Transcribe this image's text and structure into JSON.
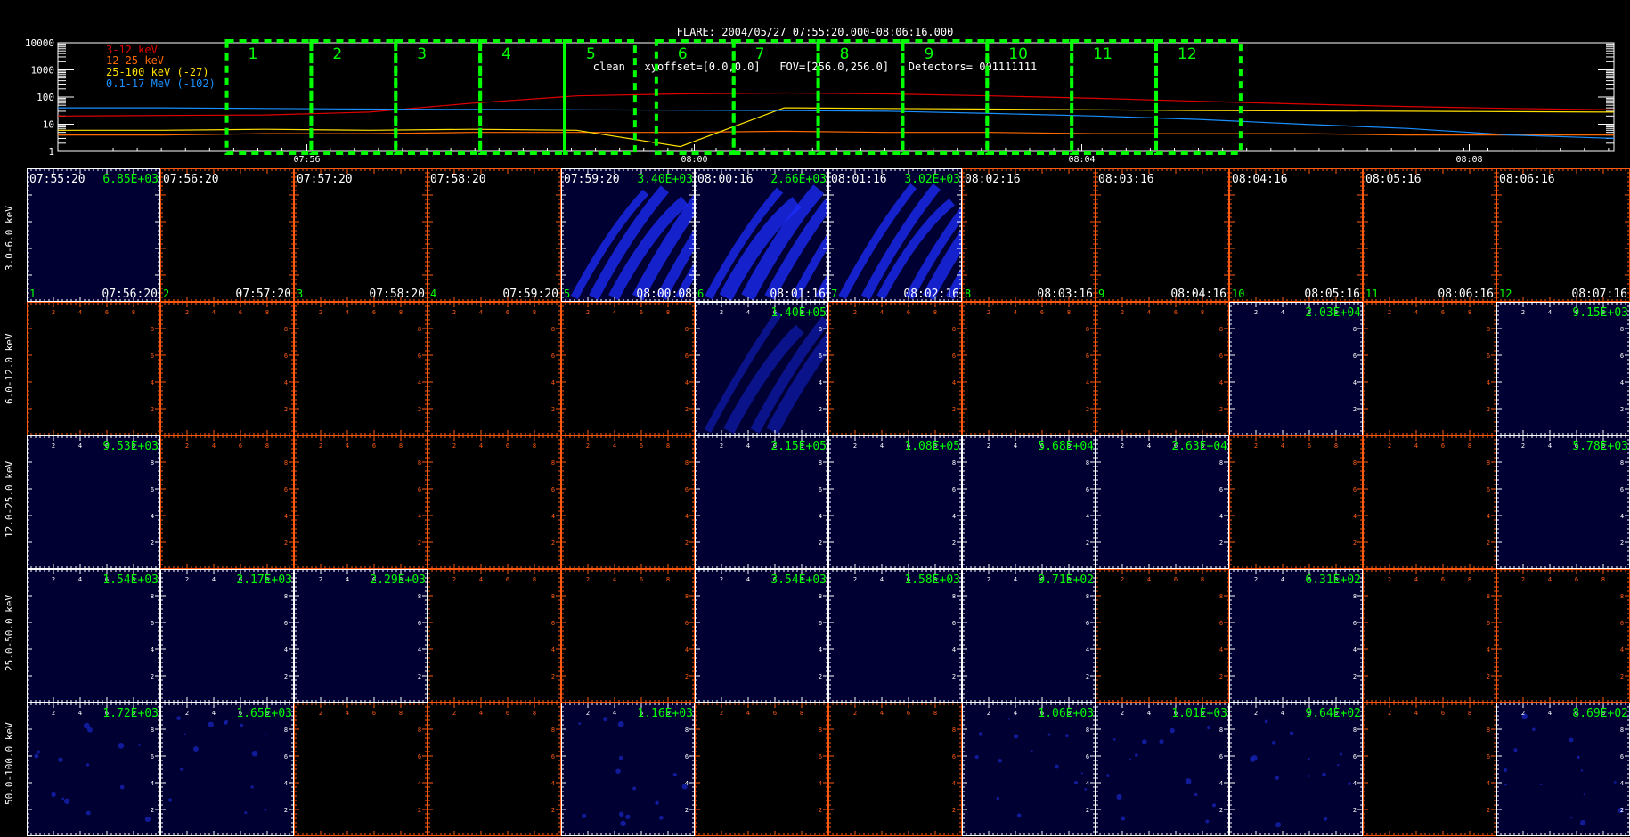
{
  "header": {
    "title": "FLARE: 2004/05/27 07:55:20.000-08:06:16.000",
    "subtitle": "clean   xyoffset=[0.0,0.0]   FOV=[256.0,256.0]   Detectors= 001111111"
  },
  "colors": {
    "frame": "#ff5a10",
    "panel_bg": "#000033",
    "window_box": "#00ff00",
    "label_green": "#00ff00",
    "series": [
      "#e00000",
      "#ff6a00",
      "#ffe000",
      "#1a90ff"
    ]
  },
  "chart_data": [
    {
      "type": "line",
      "yscale": "log",
      "ylim": [
        1,
        10000
      ],
      "yticks": [
        "10000",
        "1000",
        "100",
        "10",
        "1"
      ],
      "xticks": [
        "07:56",
        "08:00",
        "08:04",
        "08:08"
      ],
      "legend": [
        "3-12 keV",
        "12-25 keV",
        "25-100 keV (-27)",
        "0.1-17 MeV (-102)"
      ],
      "legend_position": "top-left",
      "series": [
        {
          "name": "3-12 keV",
          "values": [
            20,
            21,
            22,
            28,
            60,
            110,
            130,
            140,
            130,
            110,
            90,
            70,
            55,
            45,
            38,
            34
          ]
        },
        {
          "name": "12-25 keV",
          "values": [
            4,
            4,
            4.5,
            4.5,
            5,
            5,
            5,
            5.5,
            5,
            5,
            4.5,
            4.5,
            4.5,
            4,
            4,
            4
          ]
        },
        {
          "name": "25-100 keV (-27)",
          "values": [
            6,
            6,
            6.5,
            6,
            6.5,
            6,
            1.5,
            40,
            38,
            36,
            34,
            32,
            31,
            30,
            29,
            28
          ]
        },
        {
          "name": "0.1-17 MeV (-102)",
          "values": [
            40,
            40,
            38,
            36,
            35,
            34,
            33,
            32,
            30,
            25,
            20,
            15,
            10,
            7,
            4,
            3
          ]
        }
      ],
      "windows": [
        "1",
        "2",
        "3",
        "4",
        "5",
        "6",
        "7",
        "8",
        "9",
        "10",
        "11",
        "12"
      ]
    },
    {
      "type": "heatmap",
      "rows": [
        "3.0-6.0 keV",
        "6.0-12.0 keV",
        "12.0-25.0 keV",
        "25.0-50.0 keV",
        "50.0-100.0 keV"
      ],
      "columns": [
        "1",
        "2",
        "3",
        "4",
        "5",
        "6",
        "7",
        "8",
        "9",
        "10",
        "11",
        "12"
      ],
      "start_times": [
        "07:55:20",
        "07:56:20",
        "07:57:20",
        "07:58:20",
        "07:59:20",
        "08:00:16",
        "08:01:16",
        "08:02:16",
        "08:03:16",
        "08:04:16",
        "08:05:16",
        "08:06:16"
      ],
      "end_times": [
        "07:56:20",
        "07:57:20",
        "07:58:20",
        "07:59:20",
        "08:00:08",
        "08:01:16",
        "08:02:16",
        "08:03:16",
        "08:04:16",
        "08:05:16",
        "08:06:16",
        "08:07:16"
      ],
      "tick_labels": [
        "2",
        "4",
        "6",
        "8"
      ],
      "peaks": [
        [
          "6.85E+03",
          "",
          "",
          "",
          "3.40E+03",
          "2.66E+03",
          "3.02E+03",
          "",
          "",
          "",
          "",
          ""
        ],
        [
          "",
          "",
          "",
          "",
          "",
          "1.40E+05",
          "",
          "",
          "",
          "2.03E+04",
          "",
          "9.15E+03"
        ],
        [
          "9.53E+03",
          "",
          "",
          "",
          "",
          "2.15E+05",
          "1.08E+05",
          "5.68E+04",
          "2.63E+04",
          "",
          "",
          "5.78E+03"
        ],
        [
          "1.54E+03",
          "2.17E+03",
          "2.29E+03",
          "",
          "",
          "3.54E+03",
          "1.58E+03",
          "9.71E+02",
          "",
          "6.31E+02",
          "",
          ""
        ],
        [
          "1.72E+03",
          "1.65E+03",
          "",
          "",
          "1.16E+03",
          "",
          "",
          "1.06E+03",
          "1.01E+03",
          "9.64E+02",
          "",
          "8.69E+02"
        ]
      ],
      "tint": [
        [
          "dark",
          "none",
          "none",
          "none",
          "bright",
          "bright",
          "bright",
          "none",
          "none",
          "none",
          "none",
          "none"
        ],
        [
          "none",
          "none",
          "none",
          "none",
          "none",
          "streak",
          "none",
          "none",
          "none",
          "dark",
          "none",
          "dark"
        ],
        [
          "dark",
          "none",
          "none",
          "none",
          "none",
          "dark",
          "dark",
          "dark",
          "dark",
          "none",
          "none",
          "dark"
        ],
        [
          "dark",
          "dark",
          "dark",
          "none",
          "none",
          "dark",
          "dark",
          "dark",
          "none",
          "dark",
          "none",
          "none"
        ],
        [
          "speck",
          "speck",
          "none",
          "none",
          "speck",
          "none",
          "none",
          "speck",
          "speck",
          "speck",
          "none",
          "speck"
        ]
      ]
    }
  ]
}
